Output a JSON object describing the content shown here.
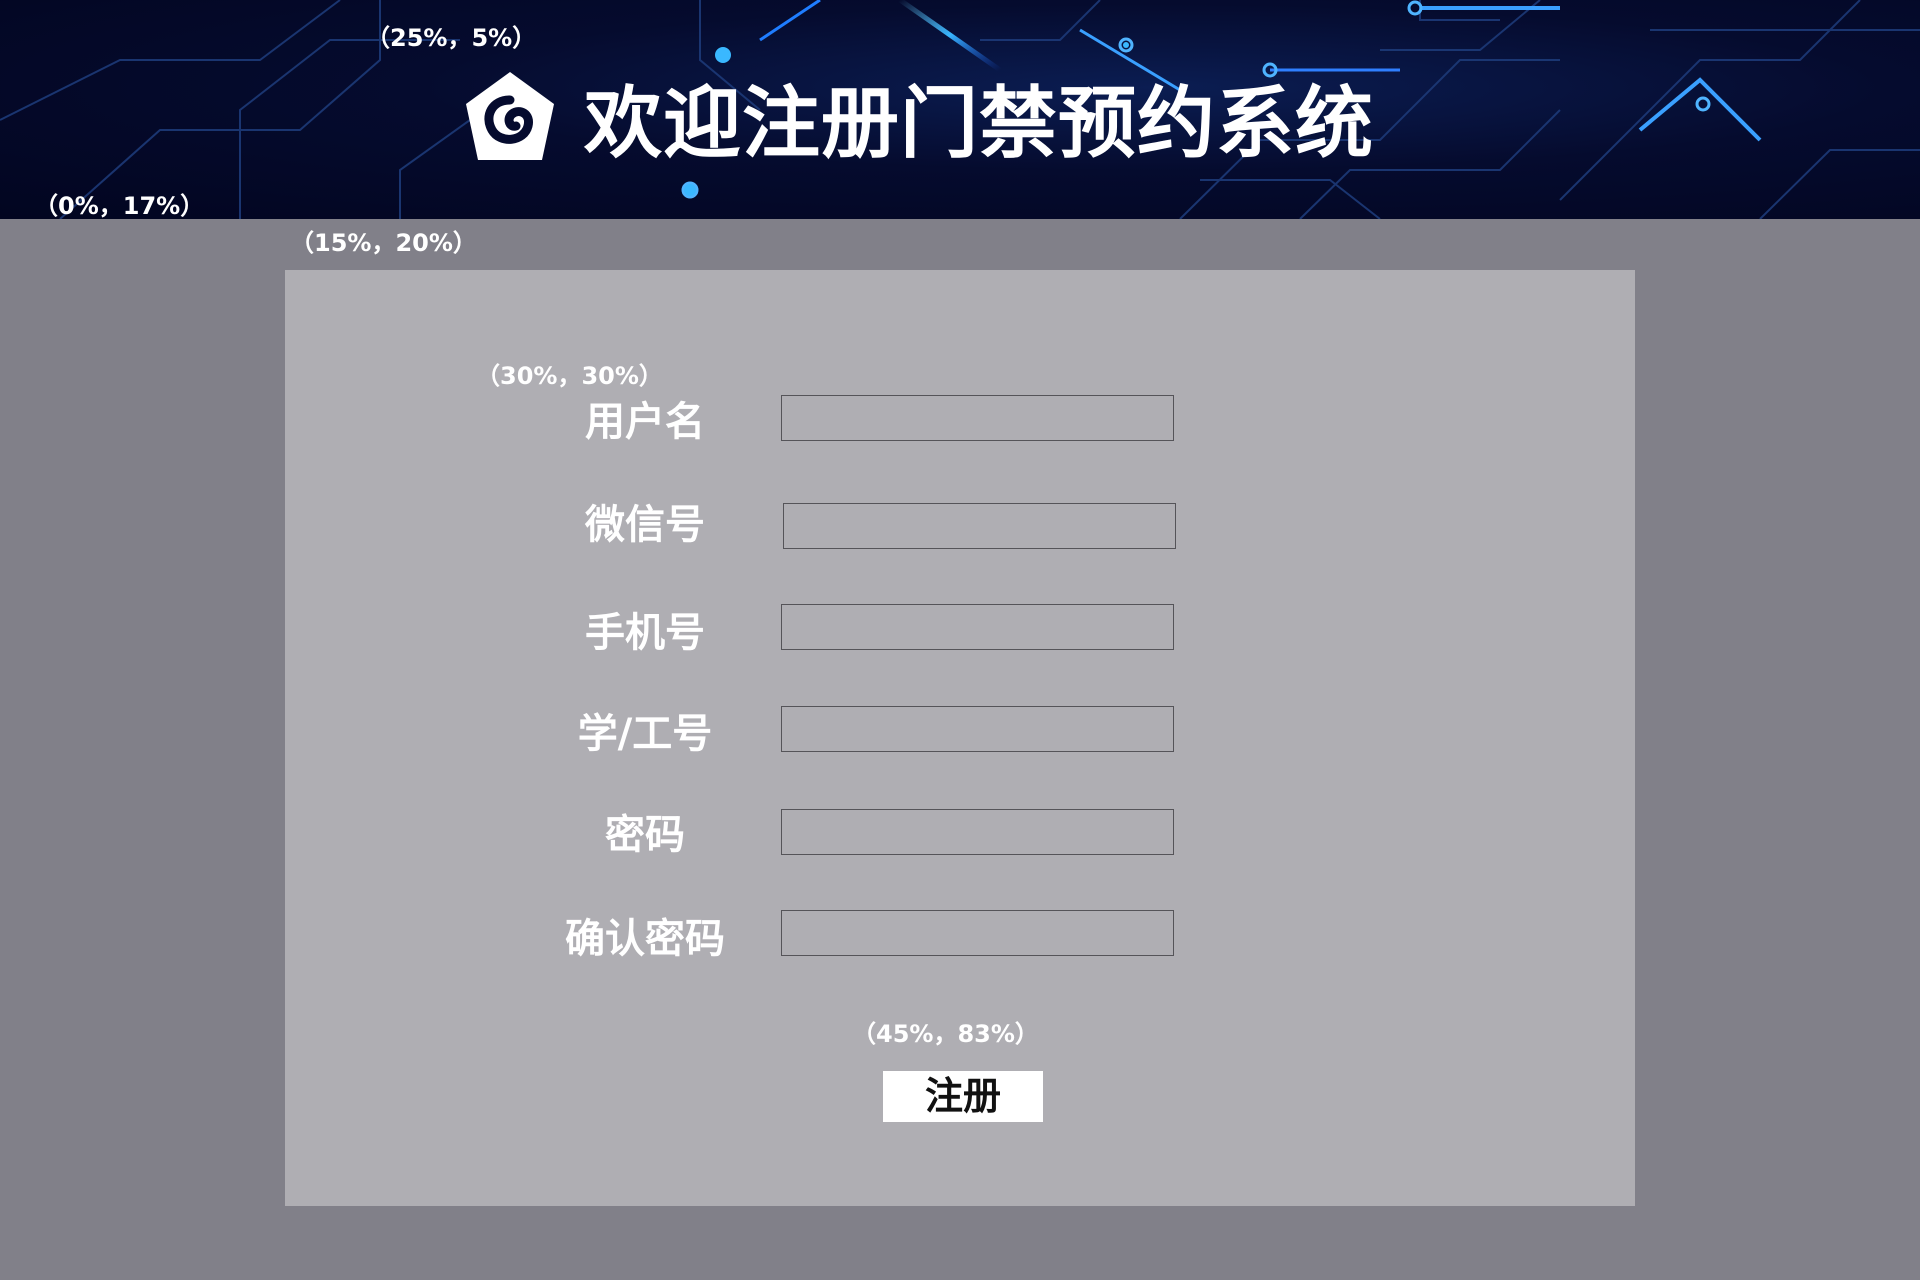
{
  "header": {
    "title": "欢迎注册门禁预约系统",
    "logo_icon": "house-swirl-icon",
    "coord_title": "（25%，5%）",
    "coord_left": "（0%，17%）"
  },
  "panel": {
    "coord_panel": "（15%，20%）",
    "coord_form": "（30%，30%）",
    "coord_button": "（45%，83%）"
  },
  "form": {
    "fields": [
      {
        "label": "用户名",
        "value": "",
        "placeholder": ""
      },
      {
        "label": "微信号",
        "value": "",
        "placeholder": ""
      },
      {
        "label": "手机号",
        "value": "",
        "placeholder": ""
      },
      {
        "label": "学/工号",
        "value": "",
        "placeholder": ""
      },
      {
        "label": "密码",
        "value": "",
        "placeholder": ""
      },
      {
        "label": "确认密码",
        "value": "",
        "placeholder": ""
      }
    ],
    "submit_label": "注册"
  },
  "colors": {
    "background": "#818089",
    "panel": "#afaeb3",
    "banner_dark": "#050b2e",
    "circuit_glow": "#2a8cff",
    "text": "#ffffff"
  }
}
